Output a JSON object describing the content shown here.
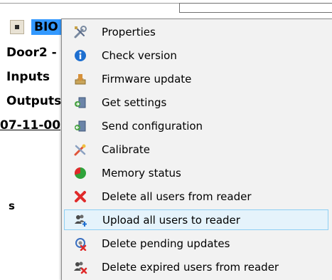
{
  "tree": {
    "selected_node": "BIO",
    "door_label": "Door2 -",
    "inputs_label": "Inputs",
    "outputs_label": "Outputs",
    "date_label": "07-11-00",
    "partial_label": "s"
  },
  "context_menu": {
    "items": [
      {
        "label": "Properties",
        "icon": "wrench-screwdriver-icon"
      },
      {
        "label": "Check version",
        "icon": "info-icon"
      },
      {
        "label": "Firmware update",
        "icon": "firmware-update-icon"
      },
      {
        "label": "Get settings",
        "icon": "get-settings-icon"
      },
      {
        "label": "Send configuration",
        "icon": "send-configuration-icon"
      },
      {
        "label": "Calibrate",
        "icon": "calibrate-icon"
      },
      {
        "label": "Memory status",
        "icon": "pie-chart-icon"
      },
      {
        "label": "Delete all users from reader",
        "icon": "red-x-icon"
      },
      {
        "label": "Upload all users to reader",
        "icon": "users-upload-icon"
      },
      {
        "label": "Delete pending updates",
        "icon": "delete-pending-icon"
      },
      {
        "label": "Delete expired users from reader",
        "icon": "delete-expired-users-icon"
      }
    ],
    "highlighted_index": 8
  },
  "colors": {
    "selection": "#3399ff",
    "menu_background": "#f2f2f2",
    "hover_fill": "#e5f3fb",
    "hover_border": "#8dcff4",
    "info_blue": "#1e6fd0",
    "delete_red": "#e02a2a",
    "memory_green": "#2fa33a"
  }
}
